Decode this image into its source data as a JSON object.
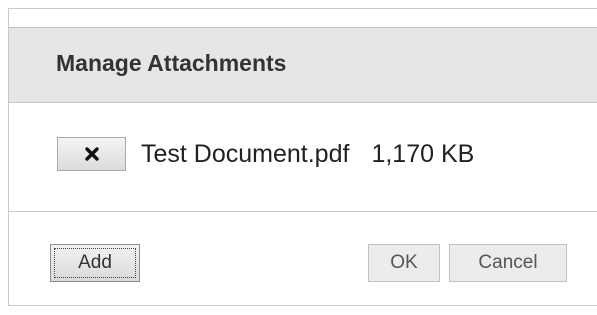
{
  "dialog": {
    "title": "Manage Attachments"
  },
  "attachments": [
    {
      "name": "Test Document.pdf",
      "size": "1,170 KB",
      "remove_icon": "close-x-icon"
    }
  ],
  "footer": {
    "add_label": "Add",
    "ok_label": "OK",
    "cancel_label": "Cancel"
  },
  "colors": {
    "header_bg": "#e6e6e6",
    "button_bg": "#ececec",
    "text": "#333333",
    "border": "#c9c9c9"
  }
}
